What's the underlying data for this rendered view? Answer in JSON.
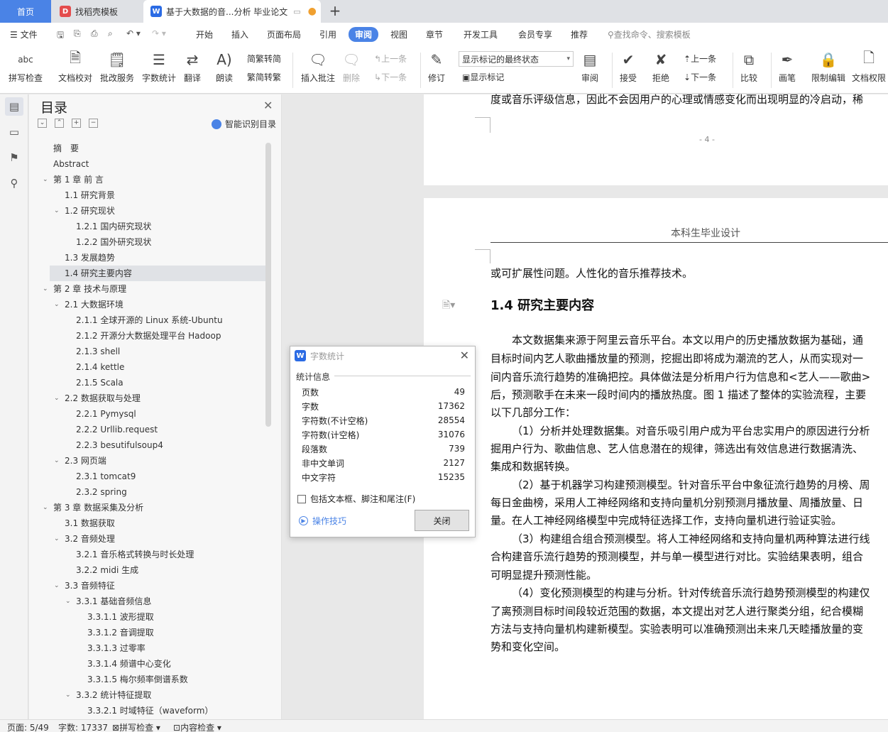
{
  "tabs": {
    "home": "首页",
    "template": "找稻壳模板",
    "doc": "基于大数据的音...分析 毕业论文",
    "doc_icon": "W",
    "template_icon": "D",
    "new_tab": "+"
  },
  "menu": {
    "file": "文件",
    "items": [
      "开始",
      "插入",
      "页面布局",
      "引用",
      "审阅",
      "视图",
      "章节",
      "开发工具",
      "会员专享",
      "推荐"
    ],
    "active": "审阅",
    "search": "查找命令、搜索模板"
  },
  "ribbon": {
    "spell": "拼写检查",
    "proof": "文档校对",
    "batch": "批改服务",
    "wordcount": "字数统计",
    "translate": "翻译",
    "read": "朗读",
    "trad": "繁转简",
    "simp": "简转繁",
    "insert_comment": "插入批注",
    "delete": "删除",
    "prev": "上一条",
    "next": "下一条",
    "revise": "修订",
    "markup_state": "显示标记的最终状态",
    "show_markup": "显示标记",
    "review": "审阅",
    "accept": "接受",
    "reject": "拒绝",
    "prev2": "上一条",
    "next2": "下一条",
    "compare": "比较",
    "ink": "画笔",
    "restrict": "限制编辑",
    "perm": "文档权限",
    "spell_icon": "abc"
  },
  "toc": {
    "title": "目录",
    "smart": "智能识别目录",
    "items": [
      {
        "text": "摘　要",
        "level": 0,
        "chev": ""
      },
      {
        "text": "Abstract",
        "level": 0,
        "chev": ""
      },
      {
        "text": "第 1 章  前  言",
        "level": 0,
        "chev": "v"
      },
      {
        "text": "1.1  研究背景",
        "level": 1,
        "chev": ""
      },
      {
        "text": "1.2  研究现状",
        "level": 1,
        "chev": "v"
      },
      {
        "text": "1.2.1  国内研究现状",
        "level": 2,
        "chev": ""
      },
      {
        "text": "1.2.2  国外研究现状",
        "level": 2,
        "chev": ""
      },
      {
        "text": "1.3  发展趋势",
        "level": 1,
        "chev": ""
      },
      {
        "text": "1.4  研究主要内容",
        "level": 1,
        "chev": "",
        "sel": true
      },
      {
        "text": "第 2 章  技术与原理",
        "level": 0,
        "chev": "v"
      },
      {
        "text": "2.1  大数据环境",
        "level": 1,
        "chev": "v"
      },
      {
        "text": "2.1.1  全球开源的 Linux 系统-Ubuntu",
        "level": 2,
        "chev": ""
      },
      {
        "text": "2.1.2  开源分大数据处理平台 Hadoop",
        "level": 2,
        "chev": ""
      },
      {
        "text": "2.1.3 shell",
        "level": 2,
        "chev": ""
      },
      {
        "text": "2.1.4 kettle",
        "level": 2,
        "chev": ""
      },
      {
        "text": "2.1.5 Scala",
        "level": 2,
        "chev": ""
      },
      {
        "text": "2.2  数据获取与处理",
        "level": 1,
        "chev": "v"
      },
      {
        "text": "2.2.1 Pymysql",
        "level": 2,
        "chev": ""
      },
      {
        "text": "2.2.2 Urllib.request",
        "level": 2,
        "chev": ""
      },
      {
        "text": "2.2.3 besutifulsoup4",
        "level": 2,
        "chev": ""
      },
      {
        "text": "2.3 网页端",
        "level": 1,
        "chev": "v"
      },
      {
        "text": "2.3.1 tomcat9",
        "level": 2,
        "chev": ""
      },
      {
        "text": "2.3.2 spring",
        "level": 2,
        "chev": ""
      },
      {
        "text": "第 3 章  数据采集及分析",
        "level": 0,
        "chev": "v"
      },
      {
        "text": "3.1  数据获取",
        "level": 1,
        "chev": ""
      },
      {
        "text": "3.2  音频处理",
        "level": 1,
        "chev": "v"
      },
      {
        "text": "3.2.1  音乐格式转换与时长处理",
        "level": 2,
        "chev": ""
      },
      {
        "text": "3.2.2 midi 生成",
        "level": 2,
        "chev": ""
      },
      {
        "text": "3.3  音频特征",
        "level": 1,
        "chev": "v"
      },
      {
        "text": "3.3.1  基础音频信息",
        "level": 2,
        "chev": "v"
      },
      {
        "text": "3.3.1.1  波形提取",
        "level": 3,
        "chev": ""
      },
      {
        "text": "3.3.1.2  音调提取",
        "level": 3,
        "chev": ""
      },
      {
        "text": "3.3.1.3  过零率",
        "level": 3,
        "chev": ""
      },
      {
        "text": "3.3.1.4  频谱中心变化",
        "level": 3,
        "chev": ""
      },
      {
        "text": "3.3.1.5  梅尔频率倒谱系数",
        "level": 3,
        "chev": ""
      },
      {
        "text": "3.3.2  统计特征提取",
        "level": 2,
        "chev": "v"
      },
      {
        "text": "3.3.2.1  时域特征（waveform）",
        "level": 3,
        "chev": ""
      }
    ]
  },
  "doc": {
    "prev_line": "度或音乐评级信息，因此不会因用户的心理或情感变化而出现明显的冷启动，稀",
    "page_num": "- 4 -",
    "header": "本科生毕业设计",
    "lines": [
      {
        "t": "或可扩展性问题。人性化的音乐推荐技术。",
        "indent": 0
      },
      {
        "t": "1.4  研究主要内容",
        "heading": true
      },
      {
        "t": "本文数据集来源于阿里云音乐平台。本文以用户的历史播放数据为基础，通",
        "indent": 1
      },
      {
        "t": "目标时间内艺人歌曲播放量的预测，挖掘出即将成为潮流的艺人，从而实现对一",
        "indent": 0
      },
      {
        "t": "间内音乐流行趋势的准确把控。具体做法是分析用户行为信息和<艺人——歌曲>",
        "indent": 0
      },
      {
        "t": "后，预测歌手在未来一段时间内的播放热度。图 1 描述了整体的实验流程，主要",
        "indent": 0
      },
      {
        "t": "以下几部分工作：",
        "indent": 0
      },
      {
        "t": "（1）分析并处理数据集。对音乐吸引用户成为平台忠实用户的原因进行分析",
        "indent": 1
      },
      {
        "t": "掘用户行为、歌曲信息、艺人信息潜在的规律，筛选出有效信息进行数据清洗、",
        "indent": 0
      },
      {
        "t": "集成和数据转换。",
        "indent": 0
      },
      {
        "t": "（2）基于机器学习构建预测模型。针对音乐平台中象征流行趋势的月榜、周",
        "indent": 1
      },
      {
        "t": "每日金曲榜，采用人工神经网络和支持向量机分别预测月播放量、周播放量、日",
        "indent": 0
      },
      {
        "t": "量。在人工神经网络模型中完成特征选择工作，支持向量机进行验证实验。",
        "indent": 0
      },
      {
        "t": "（3）构建组合组合预测模型。将人工神经网络和支持向量机两种算法进行线",
        "indent": 1
      },
      {
        "t": "合构建音乐流行趋势的预测模型，并与单一模型进行对比。实验结果表明，组合",
        "indent": 0
      },
      {
        "t": "可明显提升预测性能。",
        "indent": 0
      },
      {
        "t": "（4）变化预测模型的构建与分析。针对传统音乐流行趋势预测模型的构建仅",
        "indent": 1
      },
      {
        "t": "了离预测目标时间段较近范围的数据，本文提出对艺人进行聚类分组，纪合模糊",
        "indent": 0
      },
      {
        "t": "方法与支持向量机构建新模型。实验表明可以准确预测出未来几天睦播放量的变",
        "indent": 0
      },
      {
        "t": "势和变化空间。",
        "indent": 0
      }
    ]
  },
  "dialog": {
    "title": "字数统计",
    "section": "统计信息",
    "rows": [
      {
        "label": "页数",
        "value": "49"
      },
      {
        "label": "字数",
        "value": "17362"
      },
      {
        "label": "字符数(不计空格)",
        "value": "28554"
      },
      {
        "label": "字符数(计空格)",
        "value": "31076"
      },
      {
        "label": "段落数",
        "value": "739"
      },
      {
        "label": "非中文单词",
        "value": "2127"
      },
      {
        "label": "中文字符",
        "value": "15235"
      }
    ],
    "checkbox": "包括文本框、脚注和尾注(F)",
    "tips": "操作技巧",
    "close": "关闭"
  },
  "status": {
    "page": "页面: 5/49",
    "words": "字数: 17337",
    "spell": "拼写检查",
    "content": "内容检查"
  },
  "colors": {
    "accent": "#4a83e6",
    "wps_icon": "#2b6be4",
    "daoke_icon": "#e44d4d"
  }
}
